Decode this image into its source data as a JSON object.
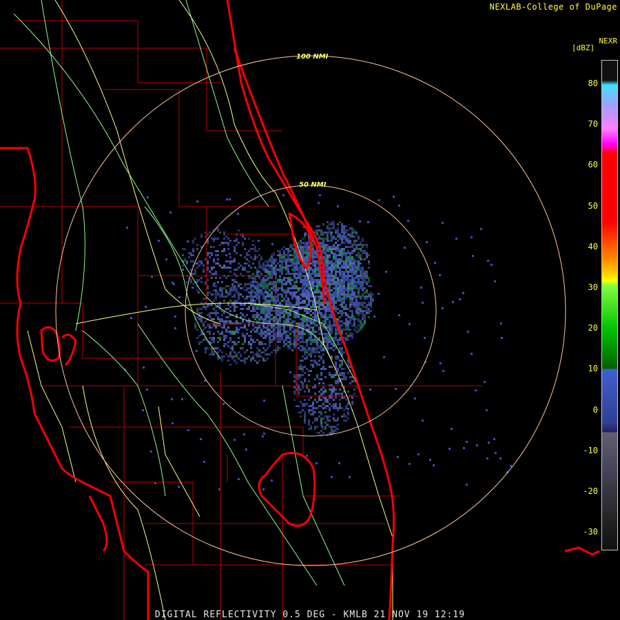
{
  "credit": "NEXLAB-College of DuPage",
  "product": "NEXR",
  "unit": "[dBZ]",
  "colorbar": {
    "ticks": [
      "80",
      "70",
      "60",
      "50",
      "40",
      "30",
      "20",
      "10",
      "0",
      "-10",
      "-20",
      "-30"
    ],
    "colors": {
      "top": "#101010",
      "cyan": "#40e0ff",
      "magenta": "#ff00ff",
      "red": "#ff0000",
      "orange": "#ff8000",
      "yellow": "#ffff00",
      "green": "#00c000",
      "blue": "#4060d0",
      "gray": "#606070",
      "black": "#101010"
    }
  },
  "rings": [
    {
      "label": "50 NMI"
    },
    {
      "label": "100 NMI"
    }
  ],
  "footer": "DIGITAL REFLECTIVITY 0.5 DEG - KMLB 21 NOV 19 12:19",
  "colors": {
    "coast": "#ff0000",
    "county": "#c00000",
    "highway": "#ffff80",
    "road": "#90ff90",
    "ring": "#ffc8a0"
  }
}
